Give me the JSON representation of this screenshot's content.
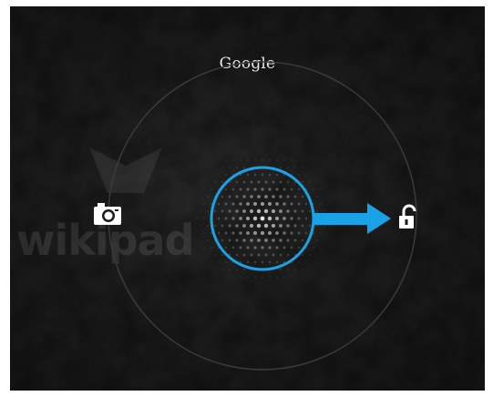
{
  "lockscreen": {
    "brand_label": "Google",
    "watermark_text": "wikipad",
    "camera_target": {
      "icon": "camera-icon"
    },
    "unlock_target": {
      "icon": "unlock-icon"
    },
    "unlock_handle": {
      "icon": "lock-handle"
    },
    "swipe_arrow": {
      "icon": "arrow-right-icon"
    }
  },
  "colors": {
    "background": "#1b1b1b",
    "ring": "#3a3a3a",
    "accent": "#19a3e6",
    "icon": "#ffffff"
  }
}
